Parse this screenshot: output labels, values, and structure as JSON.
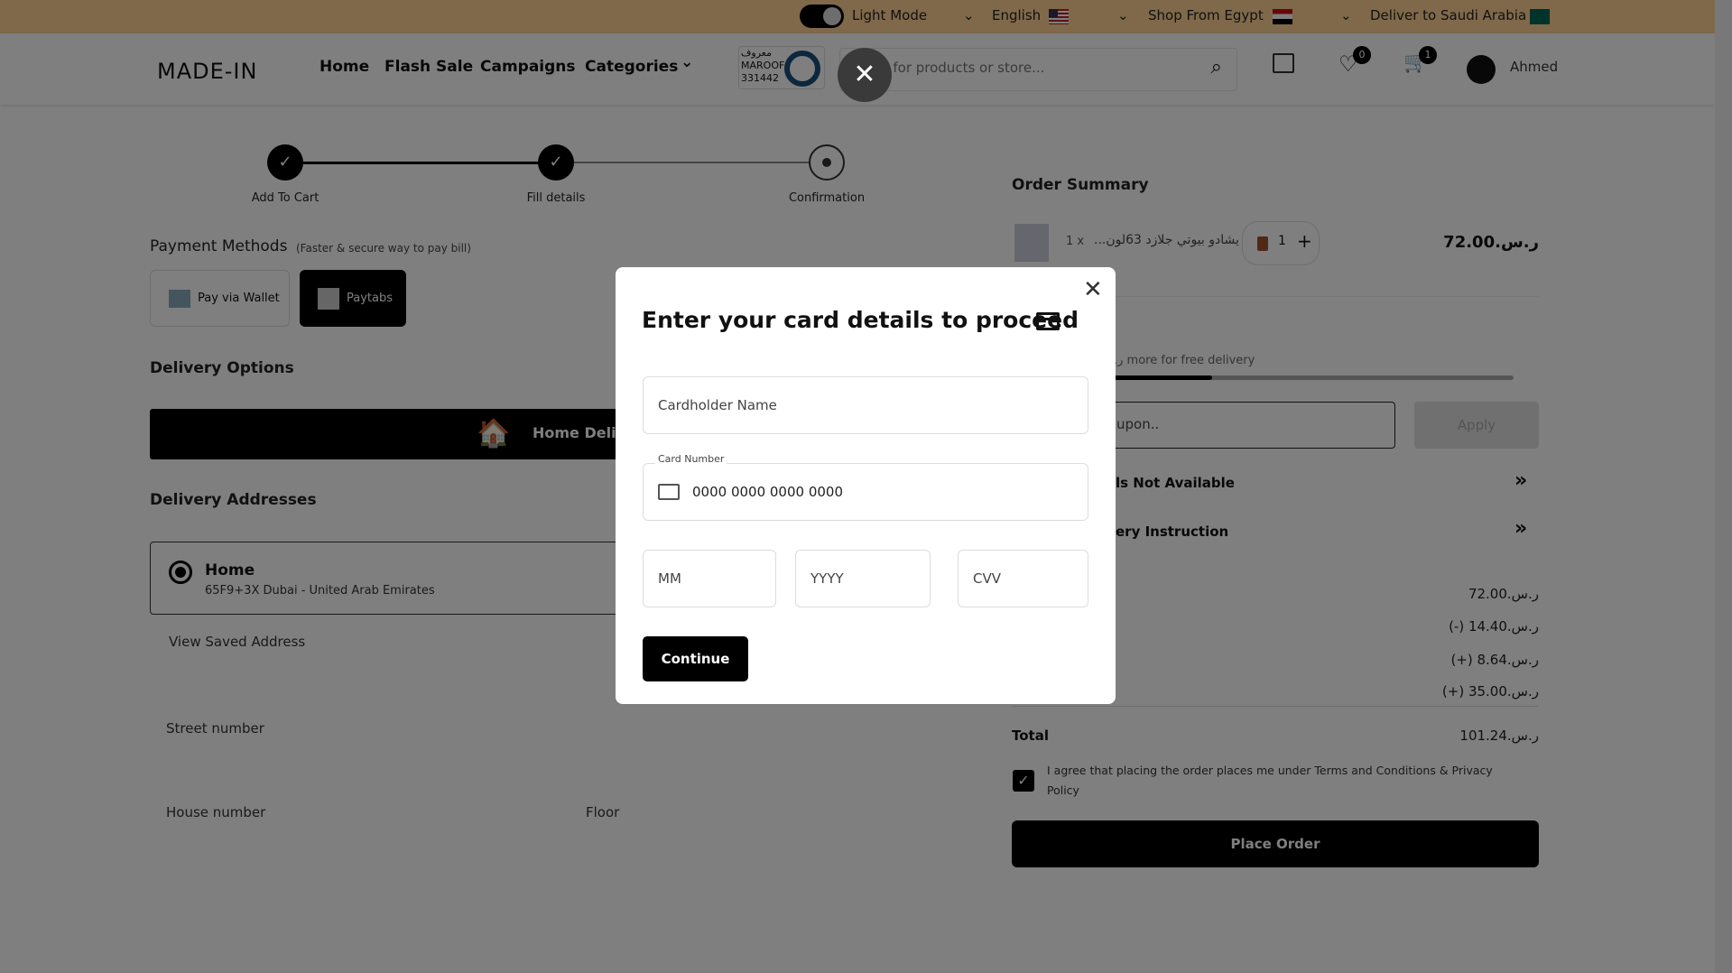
{
  "topbar": {
    "theme_label": "Light Mode",
    "language": "English",
    "shop_from": "Shop From Egypt",
    "deliver_to": "Deliver to Saudi Arabia"
  },
  "header": {
    "logo": "MADE-IN",
    "nav": [
      "Home",
      "Flash Sale",
      "Campaigns",
      "Categories"
    ],
    "maroof": {
      "arabic": "معروف",
      "latin": "MAROOF",
      "number": "331442"
    },
    "search_placeholder": "rch for products or store...",
    "wishlist_count": "0",
    "cart_count": "1",
    "user_name": "Ahmed"
  },
  "stepper": [
    {
      "label": "Add To Cart",
      "state": "done"
    },
    {
      "label": "Fill details",
      "state": "done"
    },
    {
      "label": "Confirmation",
      "state": "current"
    }
  ],
  "payment": {
    "title": "Payment Methods",
    "subtitle": "(Faster & secure way to pay bill)",
    "methods": [
      {
        "label": "Pay via Wallet",
        "selected": false
      },
      {
        "label": "Paytabs",
        "selected": true
      }
    ]
  },
  "delivery": {
    "title": "Delivery Options",
    "option": "Home Deliv"
  },
  "addresses": {
    "title": "Delivery Addresses",
    "selected": {
      "name": "Home",
      "address": "65F9+3X Dubai - United Arab Emirates"
    },
    "view_saved": "View Saved Address"
  },
  "form": {
    "street": "Street number",
    "house": "House number",
    "floor": "Floor"
  },
  "summary": {
    "title": "Order Summary",
    "item": {
      "qty_prefix": "1 x",
      "name": "...يشادو بيوتي جلازد 63لون",
      "qty": "1",
      "price": "72.00.ر.س"
    },
    "free_delivery": ".ر more for free delivery",
    "free_delivery_progress": 0.4,
    "coupon_placeholder": "upon..",
    "apply": "Apply",
    "row1": "ls Not Available",
    "row2": "ery Instruction",
    "prices": [
      "72.00.ر.س",
      "(-) 14.40.ر.س",
      "(+) 8.64.ر.س",
      "(+) 35.00.ر.س"
    ],
    "total_label": "Total",
    "total": "101.24.ر.س",
    "agree": "I agree that placing the order places me under Terms and Conditions & Privacy Policy",
    "agree_checked": true,
    "place_order": "Place Order"
  },
  "modal": {
    "title": "Enter your card details to proceed",
    "cardholder_placeholder": "Cardholder Name",
    "card_number_label": "Card Number",
    "card_number_placeholder": "0000 0000 0000 0000",
    "mm_placeholder": "MM",
    "yyyy_placeholder": "YYYY",
    "cvv_placeholder": "CVV",
    "continue": "Continue"
  },
  "colors": {
    "topbar": "#ffd394",
    "accent": "#000000",
    "trash": "#a0522d"
  }
}
